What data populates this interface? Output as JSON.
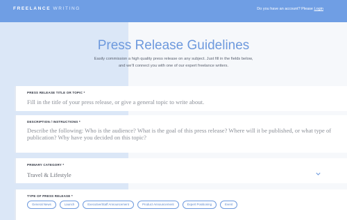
{
  "header": {
    "logo_part1": "FREELANCE",
    "logo_part2": "WRITING",
    "account_prompt": "Do you have an account? Please",
    "login_link": "Login"
  },
  "hero": {
    "title": "Press Release Guidelines",
    "subtitle_line1": "Easily commission a high quality press release on any subject. Just fill in the fields below,",
    "subtitle_line2": "and we'll connect you with one of our expert freelance writers."
  },
  "form": {
    "title_topic": {
      "label": "PRESS RELEASE TITLE OR TOPIC *",
      "placeholder": "Fill in the title of your press release, or give a general topic to write about."
    },
    "description": {
      "label": "DESCRIPTION / INSTRUCTIONS *",
      "placeholder": "Describe the following: Who is the audience? What is the goal of this press release? Where will it be published, or what type of publication? Why have you decided on this topic?"
    },
    "category": {
      "label": "PRIMARY CATEGORY *",
      "selected_value": "Travel & Lifestyle",
      "icon": "chevron-down-icon"
    },
    "type": {
      "label": "TYPE OF PRESS RELEASE *",
      "options": [
        "General News",
        "Launch",
        "Executive/Staff Announcement",
        "Product Announcement",
        "Expert Positioning",
        "Event"
      ]
    }
  },
  "colors": {
    "header_bg": "#6f9ee4",
    "accent": "#6d99dd",
    "left_panel": "#dbe7f7"
  }
}
